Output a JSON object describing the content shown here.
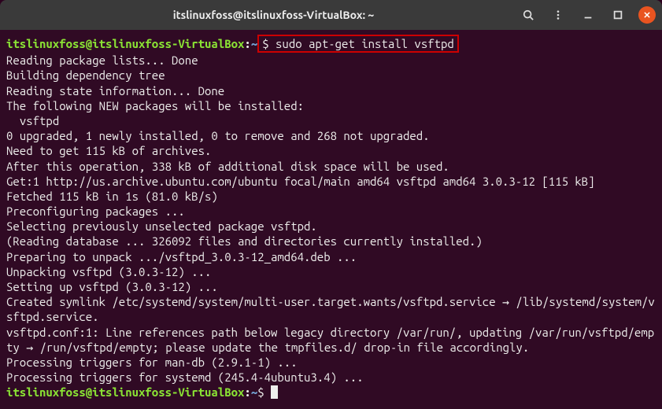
{
  "titlebar": {
    "title": "itslinuxfoss@itslinuxfoss-VirtualBox: ~"
  },
  "prompt": {
    "user_host": "itslinuxfoss@itslinuxfoss-VirtualBox",
    "colon": ":",
    "path": "~",
    "dollar": "$ "
  },
  "command": "sudo apt-get install vsftpd",
  "output": [
    "Reading package lists... Done",
    "Building dependency tree       ",
    "Reading state information... Done",
    "The following NEW packages will be installed:",
    "  vsftpd",
    "0 upgraded, 1 newly installed, 0 to remove and 268 not upgraded.",
    "Need to get 115 kB of archives.",
    "After this operation, 338 kB of additional disk space will be used.",
    "Get:1 http://us.archive.ubuntu.com/ubuntu focal/main amd64 vsftpd amd64 3.0.3-12 [115 kB]",
    "Fetched 115 kB in 1s (81.0 kB/s)",
    "Preconfiguring packages ...",
    "Selecting previously unselected package vsftpd.",
    "(Reading database ... 326092 files and directories currently installed.)",
    "Preparing to unpack .../vsftpd_3.0.3-12_amd64.deb ...",
    "Unpacking vsftpd (3.0.3-12) ...",
    "Setting up vsftpd (3.0.3-12) ...",
    "Created symlink /etc/systemd/system/multi-user.target.wants/vsftpd.service → /lib/systemd/system/vsftpd.service.",
    "vsftpd.conf:1: Line references path below legacy directory /var/run/, updating /var/run/vsftpd/empty → /run/vsftpd/empty; please update the tmpfiles.d/ drop-in file accordingly.",
    "Processing triggers for man-db (2.9.1-1) ...",
    "Processing triggers for systemd (245.4-4ubuntu3.4) ..."
  ]
}
